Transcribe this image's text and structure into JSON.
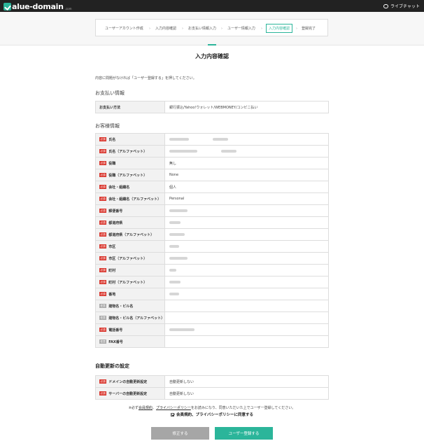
{
  "header": {
    "logo_text": "alue-domain",
    "logo_sub": ".com",
    "livechat_label": "ライブチャット"
  },
  "steps": [
    {
      "label": "ユーザーアカウント作成",
      "active": false
    },
    {
      "label": "入力内容確認",
      "active": false
    },
    {
      "label": "お支払い情報入力",
      "active": false
    },
    {
      "label": "ユーザー情報入力",
      "active": false
    },
    {
      "label": "入力内容確認",
      "active": true
    },
    {
      "label": "登録完了",
      "active": false
    }
  ],
  "step_separator": "›",
  "page_title": "入力内容確認",
  "intro_text": "内容に問題がなければ「ユーザー登録する」を押してください。",
  "payment": {
    "heading": "お支払い情報",
    "label": "お支払い方法",
    "value": "銀行振込/Yahoo!ウォレット/WEBMONEY/コンビニ払い"
  },
  "customer": {
    "heading": "お客様情報",
    "badge_required": "必須",
    "badge_optional": "任意",
    "rows": [
      {
        "label": "氏名",
        "required": true,
        "value": "",
        "blur": [
          28,
          22
        ]
      },
      {
        "label": "氏名（アルファベット）",
        "required": true,
        "value": "",
        "blur": [
          40,
          22
        ]
      },
      {
        "label": "役職",
        "required": true,
        "value": "無し"
      },
      {
        "label": "役職（アルファベット）",
        "required": true,
        "value": "None"
      },
      {
        "label": "会社・組織名",
        "required": true,
        "value": "個人"
      },
      {
        "label": "会社・組織名（アルファベット）",
        "required": true,
        "value": "Personal"
      },
      {
        "label": "郵便番号",
        "required": true,
        "value": "",
        "blur": [
          26
        ]
      },
      {
        "label": "都道府県",
        "required": true,
        "value": "",
        "blur": [
          16
        ]
      },
      {
        "label": "都道府県（アルファベット）",
        "required": true,
        "value": "",
        "blur": [
          22
        ]
      },
      {
        "label": "市区",
        "required": true,
        "value": "",
        "blur": [
          14
        ]
      },
      {
        "label": "市区（アルファベット）",
        "required": true,
        "value": "",
        "blur": [
          26
        ]
      },
      {
        "label": "町村",
        "required": true,
        "value": "",
        "blur": [
          10
        ]
      },
      {
        "label": "町村（アルファベット）",
        "required": true,
        "value": "",
        "blur": [
          16
        ]
      },
      {
        "label": "番地",
        "required": true,
        "value": "",
        "blur": [
          14
        ]
      },
      {
        "label": "建物名・ビル名",
        "required": false,
        "value": ""
      },
      {
        "label": "建物名・ビル名（アルファベット）",
        "required": false,
        "value": ""
      },
      {
        "label": "電話番号",
        "required": true,
        "value": "",
        "blur": [
          36
        ]
      },
      {
        "label": "FAX番号",
        "required": false,
        "value": ""
      }
    ]
  },
  "auto_renew": {
    "heading": "自動更新の設定",
    "rows": [
      {
        "label": "ドメインの自動更新設定",
        "required": true,
        "value": "自動更新しない"
      },
      {
        "label": "サーバーの自動更新設定",
        "required": true,
        "value": "自動更新しない"
      }
    ]
  },
  "notice": {
    "prefix": "※必ず",
    "link1": "会員規約",
    "sep": "、",
    "link2": "プライバシーポリシー",
    "suffix": "をお読みになり、同意いただいた上でユーザー登録してください。"
  },
  "agree_label": "会員規約、プライバシーポリシーに同意する",
  "buttons": {
    "back": "修正する",
    "register": "ユーザー登録する"
  },
  "colors": {
    "accent": "#2bb59a",
    "required": "#d9342b",
    "optional": "#aaaaaa",
    "back_button": "#a6a6a6"
  }
}
